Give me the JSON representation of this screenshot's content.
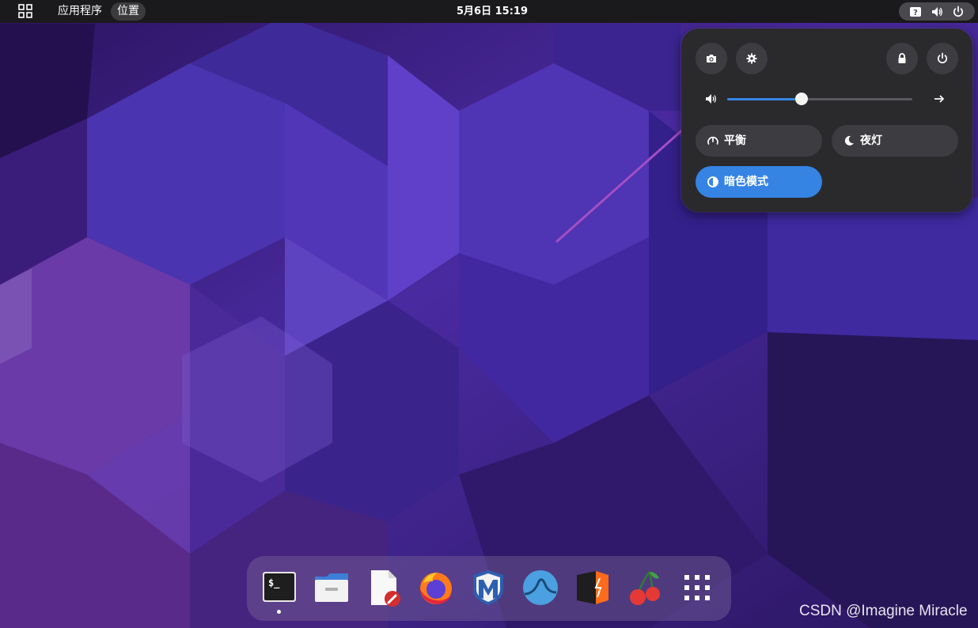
{
  "topbar": {
    "apps_menu": "应用程序",
    "places_menu": "位置",
    "clock": "5月6日  15:19",
    "tray_icons": [
      "help-icon",
      "volume-icon",
      "power-icon"
    ]
  },
  "quick_settings": {
    "top_buttons": [
      "screenshot-icon",
      "settings-icon",
      "lock-icon",
      "power-icon"
    ],
    "volume": {
      "level": 0.4,
      "accent": "#3584e4"
    },
    "toggles": [
      {
        "label": "平衡",
        "icon": "power-profile-icon",
        "active": false
      },
      {
        "label": "夜灯",
        "icon": "night-light-icon",
        "active": false
      },
      {
        "label": "暗色模式",
        "icon": "dark-mode-icon",
        "active": true
      }
    ]
  },
  "dock": {
    "apps": [
      "terminal-icon",
      "files-icon",
      "text-editor-icon",
      "firefox-icon",
      "metasploit-icon",
      "wireshark-icon",
      "burpsuite-icon",
      "cherrytree-icon",
      "show-apps-icon"
    ]
  },
  "watermark": "CSDN @Imagine Miracle",
  "colors": {
    "accent": "#3584e4",
    "panel_bg": "#2a2a2d",
    "annotation_arrow": "#a24fc4"
  }
}
